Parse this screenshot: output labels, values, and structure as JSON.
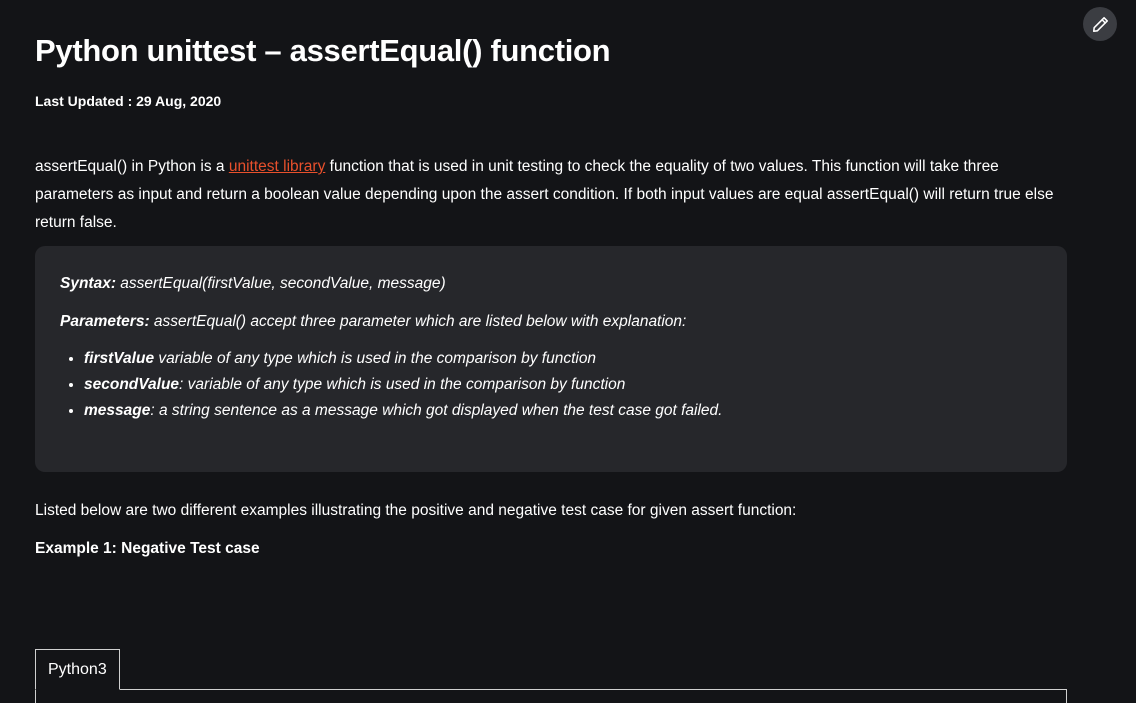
{
  "article": {
    "title": "Python unittest – assertEqual() function",
    "last_updated": "Last Updated : 29 Aug, 2020",
    "intro": {
      "before_link": "assertEqual() in Python is a ",
      "link_text": "unittest library",
      "after_link": " function that is used in unit testing to check the equality of two values. This function will take three parameters as input and return a boolean value depending upon the assert condition. If both input values are equal assertEqual() will return true else return false."
    },
    "syntax_box": {
      "syntax_label": "Syntax:",
      "syntax_text": " assertEqual(firstValue, secondValue, message)",
      "params_label": "Parameters:",
      "params_text": " assertEqual() accept three parameter which are listed below with explanation:",
      "params": [
        {
          "name": "firstValue",
          "desc": "  variable of any type which is used in the comparison by function"
        },
        {
          "name": "secondValue",
          "desc": ": variable of any type which is used in the comparison by function"
        },
        {
          "name": "message",
          "desc": ": a string sentence as a message which got displayed when the test case got failed."
        }
      ]
    },
    "listed_text": "Listed below are two different examples illustrating the positive and negative test case for given assert function:",
    "example_heading": "Example 1: Negative Test case",
    "code_tab_label": "Python3"
  },
  "colors": {
    "background": "#131417",
    "box_background": "#26272b",
    "link": "#e8502c",
    "edit_button": "#3b3d42"
  },
  "icons": {
    "edit": "pencil-icon"
  }
}
